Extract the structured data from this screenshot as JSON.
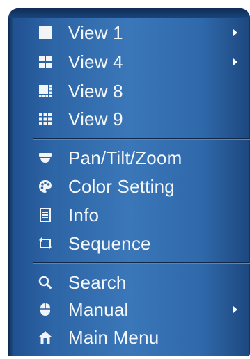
{
  "menu": {
    "groups": [
      {
        "items": [
          {
            "label": "View 1",
            "icon": "view-1-icon",
            "submenu": true
          },
          {
            "label": "View 4",
            "icon": "view-4-icon",
            "submenu": true
          },
          {
            "label": "View 8",
            "icon": "view-8-icon",
            "submenu": false
          },
          {
            "label": "View 9",
            "icon": "view-9-icon",
            "submenu": false
          }
        ]
      },
      {
        "items": [
          {
            "label": "Pan/Tilt/Zoom",
            "icon": "ptz-camera-icon",
            "submenu": false
          },
          {
            "label": "Color Setting",
            "icon": "palette-icon",
            "submenu": false
          },
          {
            "label": "Info",
            "icon": "info-document-icon",
            "submenu": false
          },
          {
            "label": "Sequence",
            "icon": "sequence-loop-icon",
            "submenu": false
          }
        ]
      },
      {
        "items": [
          {
            "label": "Search",
            "icon": "search-icon",
            "submenu": false
          },
          {
            "label": "Manual",
            "icon": "mouse-icon",
            "submenu": true
          },
          {
            "label": "Main Menu",
            "icon": "home-icon",
            "submenu": false
          }
        ]
      }
    ]
  },
  "colors": {
    "panel": "#2f6cad",
    "text": "#f4f7fb"
  }
}
